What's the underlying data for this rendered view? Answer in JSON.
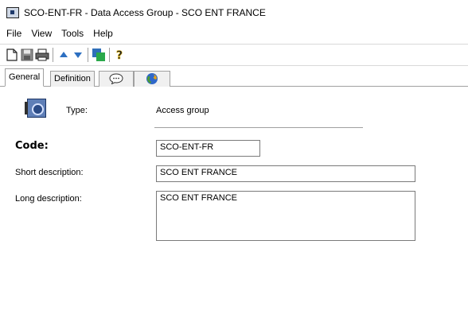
{
  "window": {
    "title": "SCO-ENT-FR - Data Access Group - SCO ENT FRANCE"
  },
  "menu": {
    "items": [
      "File",
      "View",
      "Tools",
      "Help"
    ]
  },
  "toolbar": {
    "buttons": [
      {
        "icon": "new-document-icon"
      },
      {
        "icon": "save-icon"
      },
      {
        "icon": "print-icon"
      },
      {
        "icon": "up-arrow-icon"
      },
      {
        "icon": "down-arrow-icon"
      },
      {
        "icon": "transfer-icon"
      },
      {
        "icon": "help-icon",
        "glyph": "?"
      }
    ]
  },
  "tabs": [
    {
      "label": "General",
      "active": true
    },
    {
      "label": "Definition",
      "active": false
    },
    {
      "label": "",
      "icon": "comment-icon",
      "active": false
    },
    {
      "label": "",
      "icon": "globe-icon",
      "active": false
    }
  ],
  "form": {
    "type_label": "Type:",
    "type_value": "Access group",
    "code_label": "Code:",
    "code_value": "SCO-ENT-FR",
    "short_label": "Short description:",
    "short_value": "SCO ENT FRANCE",
    "long_label": "Long description:",
    "long_value": "SCO ENT FRANCE"
  }
}
